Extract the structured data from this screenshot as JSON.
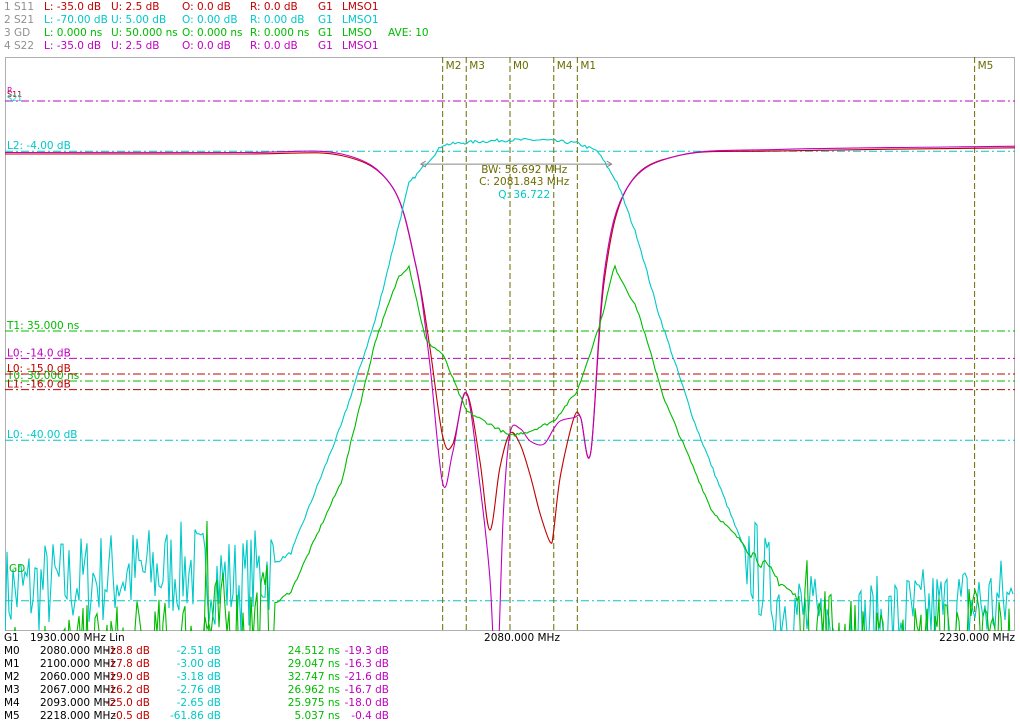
{
  "colors": {
    "s11": "#c00000",
    "s21": "#00c8c8",
    "gd": "#00bb00",
    "s22": "#c000c0",
    "marker": "#6b6b00",
    "text": "#000000",
    "dim": "#909090"
  },
  "header": {
    "traces": [
      {
        "id": "1 S11",
        "L": "L: -35.0 dB",
        "U": "U: 2.5 dB",
        "O": "O: 0.0 dB",
        "R": "R: 0.0 dB",
        "G": "G1",
        "mode": "LMSO1",
        "extra": ""
      },
      {
        "id": "2 S21",
        "L": "L: -70.00 dB",
        "U": "U: 5.00 dB",
        "O": "O: 0.00 dB",
        "R": "R: 0.00 dB",
        "G": "G1",
        "mode": "LMSO1",
        "extra": ""
      },
      {
        "id": "3 GD",
        "L": "L: 0.000 ns",
        "U": "U: 50.000 ns",
        "O": "O: 0.000 ns",
        "R": "R: 0.000 ns",
        "G": "G1",
        "mode": "LMSO",
        "extra": "AVE: 10"
      },
      {
        "id": "4 S22",
        "L": "L: -35.0 dB",
        "U": "U: 2.5 dB",
        "O": "O: 0.0 dB",
        "R": "R: 0.0 dB",
        "G": "G1",
        "mode": "LMSO1",
        "extra": ""
      }
    ]
  },
  "chart_data": {
    "type": "line",
    "x_range_mhz": [
      1930,
      2230
    ],
    "axis": {
      "group": "G1",
      "start": "1930.000 MHz Lin",
      "center": "2080.000 MHz",
      "stop": "2230.000 MHz"
    },
    "series": [
      {
        "name": "S11",
        "unit": "dB",
        "ylim": [
          -35,
          2.5
        ],
        "x": [
          1930,
          2000,
          2030,
          2045,
          2052,
          2056,
          2060,
          2063,
          2067,
          2071,
          2074,
          2077,
          2080,
          2083,
          2086,
          2089,
          2092,
          2093,
          2095,
          2099,
          2101,
          2104,
          2108,
          2115,
          2130,
          2160,
          2230
        ],
        "y": [
          -0.9,
          -0.9,
          -1.0,
          -3.0,
          -8.0,
          -13.0,
          -19.0,
          -19.5,
          -16.2,
          -20.5,
          -25.0,
          -21.0,
          -18.8,
          -19.5,
          -21.5,
          -24.0,
          -25.8,
          -25.0,
          -21.5,
          -17.8,
          -17.8,
          -20.0,
          -9.0,
          -3.0,
          -1.0,
          -0.7,
          -0.5
        ]
      },
      {
        "name": "S22",
        "unit": "dB",
        "ylim": [
          -35,
          2.5
        ],
        "x": [
          1930,
          2000,
          2030,
          2045,
          2052,
          2056,
          2060,
          2063,
          2067,
          2071,
          2074,
          2076,
          2078,
          2080,
          2083,
          2086,
          2090,
          2093,
          2095,
          2099,
          2101,
          2104,
          2108,
          2115,
          2130,
          2160,
          2230
        ],
        "y": [
          -0.8,
          -0.8,
          -0.9,
          -3.0,
          -8.0,
          -14.0,
          -22.0,
          -20.0,
          -16.2,
          -22.0,
          -28.0,
          -35.0,
          -24.0,
          -18.8,
          -18.5,
          -19.3,
          -19.5,
          -18.5,
          -18.0,
          -17.8,
          -17.8,
          -20.0,
          -8.5,
          -3.0,
          -1.0,
          -0.6,
          -0.4
        ]
      },
      {
        "name": "S21",
        "unit": "dB",
        "ylim": [
          -70,
          5
        ],
        "x": [
          1930,
          1960,
          1985,
          2000,
          2015,
          2030,
          2040,
          2050,
          2060,
          2070,
          2080,
          2090,
          2100,
          2106,
          2112,
          2118,
          2124,
          2135,
          2150,
          2160,
          2175,
          2200,
          2230
        ],
        "y": [
          -59,
          -57,
          -56,
          -58,
          -54,
          -38,
          -25,
          -8,
          -3.2,
          -2.8,
          -2.6,
          -2.6,
          -3.0,
          -4.0,
          -8.0,
          -15.0,
          -24.0,
          -38.0,
          -54.0,
          -60.0,
          -64.0,
          -61.9,
          -60.0
        ]
      },
      {
        "name": "GD",
        "unit": "ns",
        "ylim": [
          0,
          50
        ],
        "x": [
          1930,
          1950,
          1980,
          1995,
          2000,
          2015,
          2030,
          2040,
          2047,
          2050,
          2055,
          2060,
          2067,
          2075,
          2080,
          2086,
          2093,
          2100,
          2107,
          2111,
          2118,
          2126,
          2140,
          2160,
          2175,
          2190,
          2218,
          2230
        ],
        "y": [
          1.5,
          2.5,
          3.5,
          6.0,
          5.0,
          9.0,
          20.0,
          34.0,
          40.5,
          41.5,
          34.0,
          32.7,
          27.0,
          25.5,
          24.5,
          25.0,
          26.0,
          29.0,
          36.0,
          41.5,
          37.0,
          28.0,
          17.0,
          10.0,
          5.0,
          2.0,
          5.0,
          3.5
        ]
      }
    ],
    "limit_lines": [
      {
        "label": "L2: -4.00 dB",
        "value": -4.0,
        "series": "S21"
      },
      {
        "label": "L0: -40.00 dB",
        "value": -40.0,
        "series": "S21"
      },
      {
        "label": "T1: 35.000 ns",
        "value": 35.0,
        "series": "GD"
      },
      {
        "label": "T0: 30.000 ns",
        "value": 30.0,
        "series": "GD"
      },
      {
        "label": "L0: -14.0 dB",
        "value": -14.0,
        "series": "S22"
      },
      {
        "label": "L0: -15.0 dB",
        "value": -15.0,
        "series": "S11"
      },
      {
        "label": "L1: -16.0 dB",
        "value": -16.0,
        "series": "S11"
      },
      {
        "label": "",
        "value": 2.5,
        "series": "S22"
      },
      {
        "label": "",
        "value": -60.0,
        "series": "S21"
      }
    ],
    "ref_labels": {
      "s22": "R",
      "s11": "S11",
      "s21": "S21",
      "gd": "GD"
    },
    "markers": [
      {
        "name": "M0",
        "freq": 2080
      },
      {
        "name": "M1",
        "freq": 2100
      },
      {
        "name": "M2",
        "freq": 2060
      },
      {
        "name": "M3",
        "freq": 2067
      },
      {
        "name": "M4",
        "freq": 2093
      },
      {
        "name": "M5",
        "freq": 2218
      }
    ],
    "bw_annotation": {
      "bw": "BW: 56.692 MHz",
      "center": "C: 2081.843 MHz",
      "q": "Q: 36.722",
      "span_mhz": [
        2053.5,
        2110.2
      ],
      "level_db": -5.6
    }
  },
  "marker_table": {
    "rows": [
      {
        "name": "M0",
        "freq": "2080.000 MHz",
        "s11": "-18.8 dB",
        "s21": "-2.51 dB",
        "gd": "24.512 ns",
        "s22": "-19.3 dB"
      },
      {
        "name": "M1",
        "freq": "2100.000 MHz",
        "s11": "-17.8 dB",
        "s21": "-3.00 dB",
        "gd": "29.047 ns",
        "s22": "-16.3 dB"
      },
      {
        "name": "M2",
        "freq": "2060.000 MHz",
        "s11": "-19.0 dB",
        "s21": "-3.18 dB",
        "gd": "32.747 ns",
        "s22": "-21.6 dB"
      },
      {
        "name": "M3",
        "freq": "2067.000 MHz",
        "s11": "-16.2 dB",
        "s21": "-2.76 dB",
        "gd": "26.962 ns",
        "s22": "-16.7 dB"
      },
      {
        "name": "M4",
        "freq": "2093.000 MHz",
        "s11": "-25.0 dB",
        "s21": "-2.65 dB",
        "gd": "25.975 ns",
        "s22": "-18.0 dB"
      },
      {
        "name": "M5",
        "freq": "2218.000 MHz",
        "s11": "-0.5 dB",
        "s21": "-61.86 dB",
        "gd": "5.037 ns",
        "s22": "-0.4 dB"
      }
    ]
  }
}
